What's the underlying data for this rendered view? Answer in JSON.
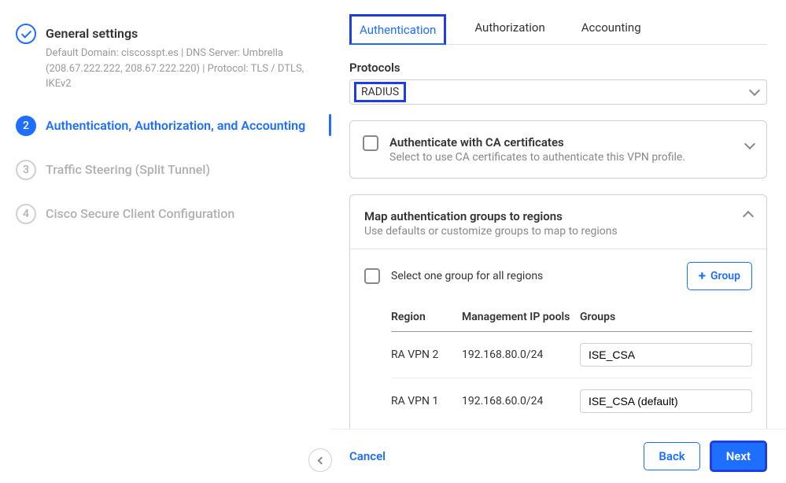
{
  "sidebar": {
    "step1": {
      "title": "General settings",
      "desc": "Default Domain: ciscosspt.es | DNS Server: Umbrella (208.67.222.222, 208.67.222.220) | Protocol: TLS / DTLS, IKEv2"
    },
    "step2": {
      "num": "2",
      "title": "Authentication, Authorization, and Accounting"
    },
    "step3": {
      "num": "3",
      "title": "Traffic Steering (Split Tunnel)"
    },
    "step4": {
      "num": "4",
      "title": "Cisco Secure Client Configuration"
    }
  },
  "tabs": {
    "auth": "Authentication",
    "authz": "Authorization",
    "acct": "Accounting"
  },
  "protocols": {
    "label": "Protocols",
    "value": "RADIUS"
  },
  "caPanel": {
    "title": "Authenticate with CA certificates",
    "sub": "Select to use CA certificates to authenticate this VPN profile."
  },
  "mapPanel": {
    "title": "Map authentication groups to regions",
    "sub": "Use defaults or customize groups to map to regions",
    "selectAll": "Select one group for all regions",
    "groupBtn": "Group",
    "headers": {
      "region": "Region",
      "ip": "Management IP pools",
      "groups": "Groups"
    },
    "rows": [
      {
        "region": "RA VPN 2",
        "ip": "192.168.80.0/24",
        "group": "ISE_CSA"
      },
      {
        "region": "RA VPN 1",
        "ip": "192.168.60.0/24",
        "group": "ISE_CSA (default)"
      }
    ]
  },
  "footer": {
    "cancel": "Cancel",
    "back": "Back",
    "next": "Next"
  }
}
